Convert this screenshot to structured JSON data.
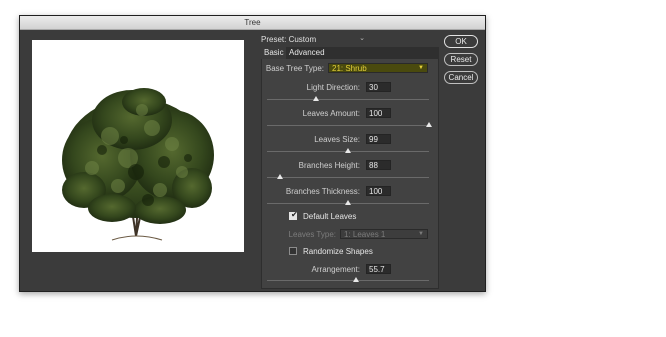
{
  "window": {
    "title": "Tree"
  },
  "preset": {
    "label": "Preset: Custom"
  },
  "tabs": {
    "basic": "Basic",
    "advanced": "Advanced"
  },
  "base_tree_type": {
    "label": "Base Tree Type:",
    "value": "21: Shrub",
    "highlight_color": "#4a4a0e",
    "text_color": "#e6d23a"
  },
  "light_direction": {
    "label": "Light Direction:",
    "value": "30",
    "level": 0.3
  },
  "leaves_amount": {
    "label": "Leaves Amount:",
    "value": "100",
    "level": 1.0
  },
  "leaves_size": {
    "label": "Leaves Size:",
    "value": "99",
    "level": 0.5
  },
  "branches_height": {
    "label": "Branches Height:",
    "value": "88",
    "level": 0.08
  },
  "branches_thickness": {
    "label": "Branches Thickness:",
    "value": "100",
    "level": 0.5
  },
  "default_leaves": {
    "label": "Default Leaves",
    "checked": true
  },
  "leaves_type": {
    "label": "Leaves Type:",
    "value": "1: Leaves 1"
  },
  "randomize_shapes": {
    "label": "Randomize Shapes",
    "checked": false
  },
  "arrangement": {
    "label": "Arrangement:",
    "value": "55.7",
    "level": 0.55
  },
  "buttons": {
    "ok": "OK",
    "reset": "Reset",
    "cancel": "Cancel"
  }
}
